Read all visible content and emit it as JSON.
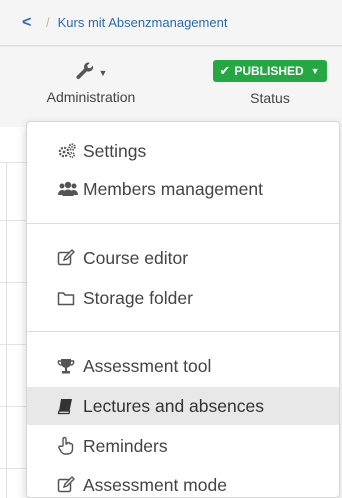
{
  "breadcrumb": {
    "back_label": "<",
    "separator": "/",
    "course_title": "Kurs mit Absenzmanagement"
  },
  "toolbar": {
    "administration_label": "Administration",
    "status_label": "Status",
    "status_badge": "PUBLISHED"
  },
  "menu": {
    "items": [
      {
        "label": "Settings",
        "icon": "gears-icon"
      },
      {
        "label": "Members management",
        "icon": "users-icon"
      },
      {
        "label": "Course editor",
        "icon": "edit-icon"
      },
      {
        "label": "Storage folder",
        "icon": "folder-icon"
      },
      {
        "label": "Assessment tool",
        "icon": "trophy-icon"
      },
      {
        "label": "Lectures and absences",
        "icon": "book-icon"
      },
      {
        "label": "Reminders",
        "icon": "pointing-hand-icon"
      },
      {
        "label": "Assessment mode",
        "icon": "edit-icon"
      }
    ],
    "active_index": 5
  },
  "colors": {
    "link": "#2b6cb0",
    "published": "#27a744",
    "active_row": "#e8e8e8"
  }
}
